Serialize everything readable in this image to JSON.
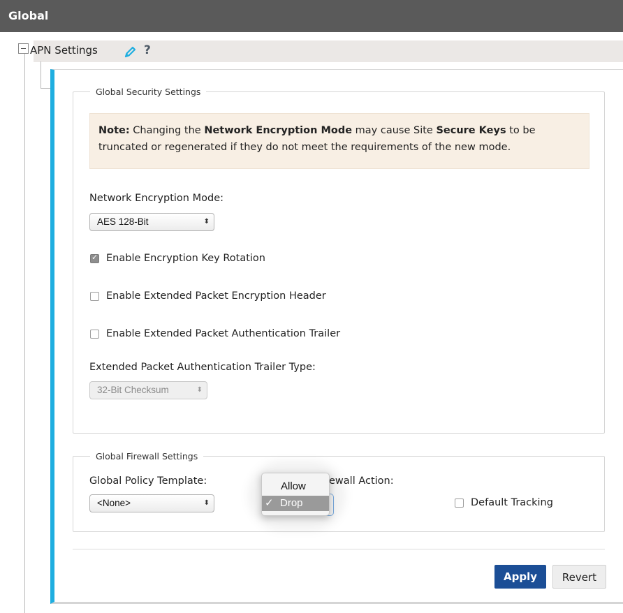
{
  "header": {
    "title": "Global"
  },
  "tree": {
    "apn_label": "APN Settings",
    "help_glyph": "?"
  },
  "security": {
    "legend": "Global Security Settings",
    "note": {
      "prefix": "Note:",
      "t1": " Changing the ",
      "b1": "Network Encryption Mode",
      "t2": " may cause Site ",
      "b2": "Secure Keys",
      "t3": " to be truncated or regenerated if they do not meet the requirements of the new mode."
    },
    "encryption_mode_label": "Network Encryption Mode:",
    "encryption_mode_value": "AES 128-Bit",
    "checkboxes": [
      {
        "label": "Enable Encryption Key Rotation",
        "checked": true
      },
      {
        "label": "Enable Extended Packet Encryption Header",
        "checked": false
      },
      {
        "label": "Enable Extended Packet Authentication Trailer",
        "checked": false
      }
    ],
    "trailer_type_label": "Extended Packet Authentication Trailer Type:",
    "trailer_type_value": "32-Bit Checksum"
  },
  "firewall": {
    "legend": "Global Firewall Settings",
    "policy_template_label": "Global Policy Template:",
    "policy_template_value": "<None>",
    "action_label_visible": "ewall Action:",
    "default_tracking_label": "Default Tracking",
    "default_tracking_checked": false,
    "action_dropdown": {
      "options": [
        "Allow",
        "Drop"
      ],
      "selected": "Drop",
      "check_glyph": "✓"
    }
  },
  "buttons": {
    "apply": "Apply",
    "revert": "Revert"
  },
  "colors": {
    "accent_bar": "#1faee0",
    "apply_bg": "#1b4e96",
    "header_bg": "#5a5a5a",
    "note_bg": "#f8efe4"
  },
  "icons": {
    "collapse": "minus-box-icon",
    "edit": "pencil-icon",
    "help": "question-icon",
    "select_arrows": "updown-arrows-icon"
  }
}
